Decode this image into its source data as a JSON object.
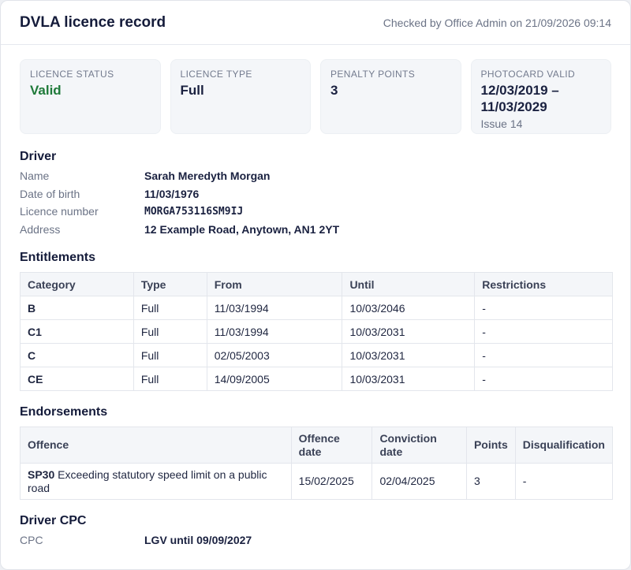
{
  "header": {
    "title": "DVLA licence record",
    "checked": "Checked by Office Admin on 21/09/2026 09:14"
  },
  "summary": [
    {
      "label": "LICENCE STATUS",
      "value": "Valid",
      "sub": ""
    },
    {
      "label": "LICENCE TYPE",
      "value": "Full",
      "sub": ""
    },
    {
      "label": "PENALTY POINTS",
      "value": "3",
      "sub": ""
    },
    {
      "label": "PHOTOCARD VALID",
      "value": "12/03/2019 – 11/03/2029",
      "sub": "Issue 14"
    }
  ],
  "colors": {
    "status_valid": "#1f7a3a"
  },
  "driver": {
    "title": "Driver",
    "rows": [
      {
        "label": "Name",
        "value": "Sarah Meredyth Morgan"
      },
      {
        "label": "Date of birth",
        "value": "11/03/1976"
      },
      {
        "label": "Licence number",
        "value": "MORGA753116SM9IJ"
      },
      {
        "label": "Address",
        "value": "12 Example Road, Anytown, AN1 2YT"
      }
    ]
  },
  "entitlements": {
    "title": "Entitlements",
    "columns": [
      "Category",
      "Type",
      "From",
      "Until",
      "Restrictions"
    ],
    "rows": [
      [
        "B",
        "Full",
        "11/03/1994",
        "10/03/2046",
        "-"
      ],
      [
        "C1",
        "Full",
        "11/03/1994",
        "10/03/2031",
        "-"
      ],
      [
        "C",
        "Full",
        "02/05/2003",
        "10/03/2031",
        "-"
      ],
      [
        "CE",
        "Full",
        "14/09/2005",
        "10/03/2031",
        "-"
      ]
    ]
  },
  "endorsements": {
    "title": "Endorsements",
    "columns": [
      "Offence",
      "Offence date",
      "Conviction date",
      "Points",
      "Disqualification"
    ],
    "rows": [
      {
        "code": "SP30",
        "offence": "Exceeding statutory speed limit on a public road",
        "offence_date": "15/02/2025",
        "conviction_date": "02/04/2025",
        "points": "3",
        "disqualification": "-"
      }
    ]
  },
  "cpc": {
    "title": "Driver CPC",
    "label": "CPC",
    "value": "LGV until 09/09/2027"
  }
}
